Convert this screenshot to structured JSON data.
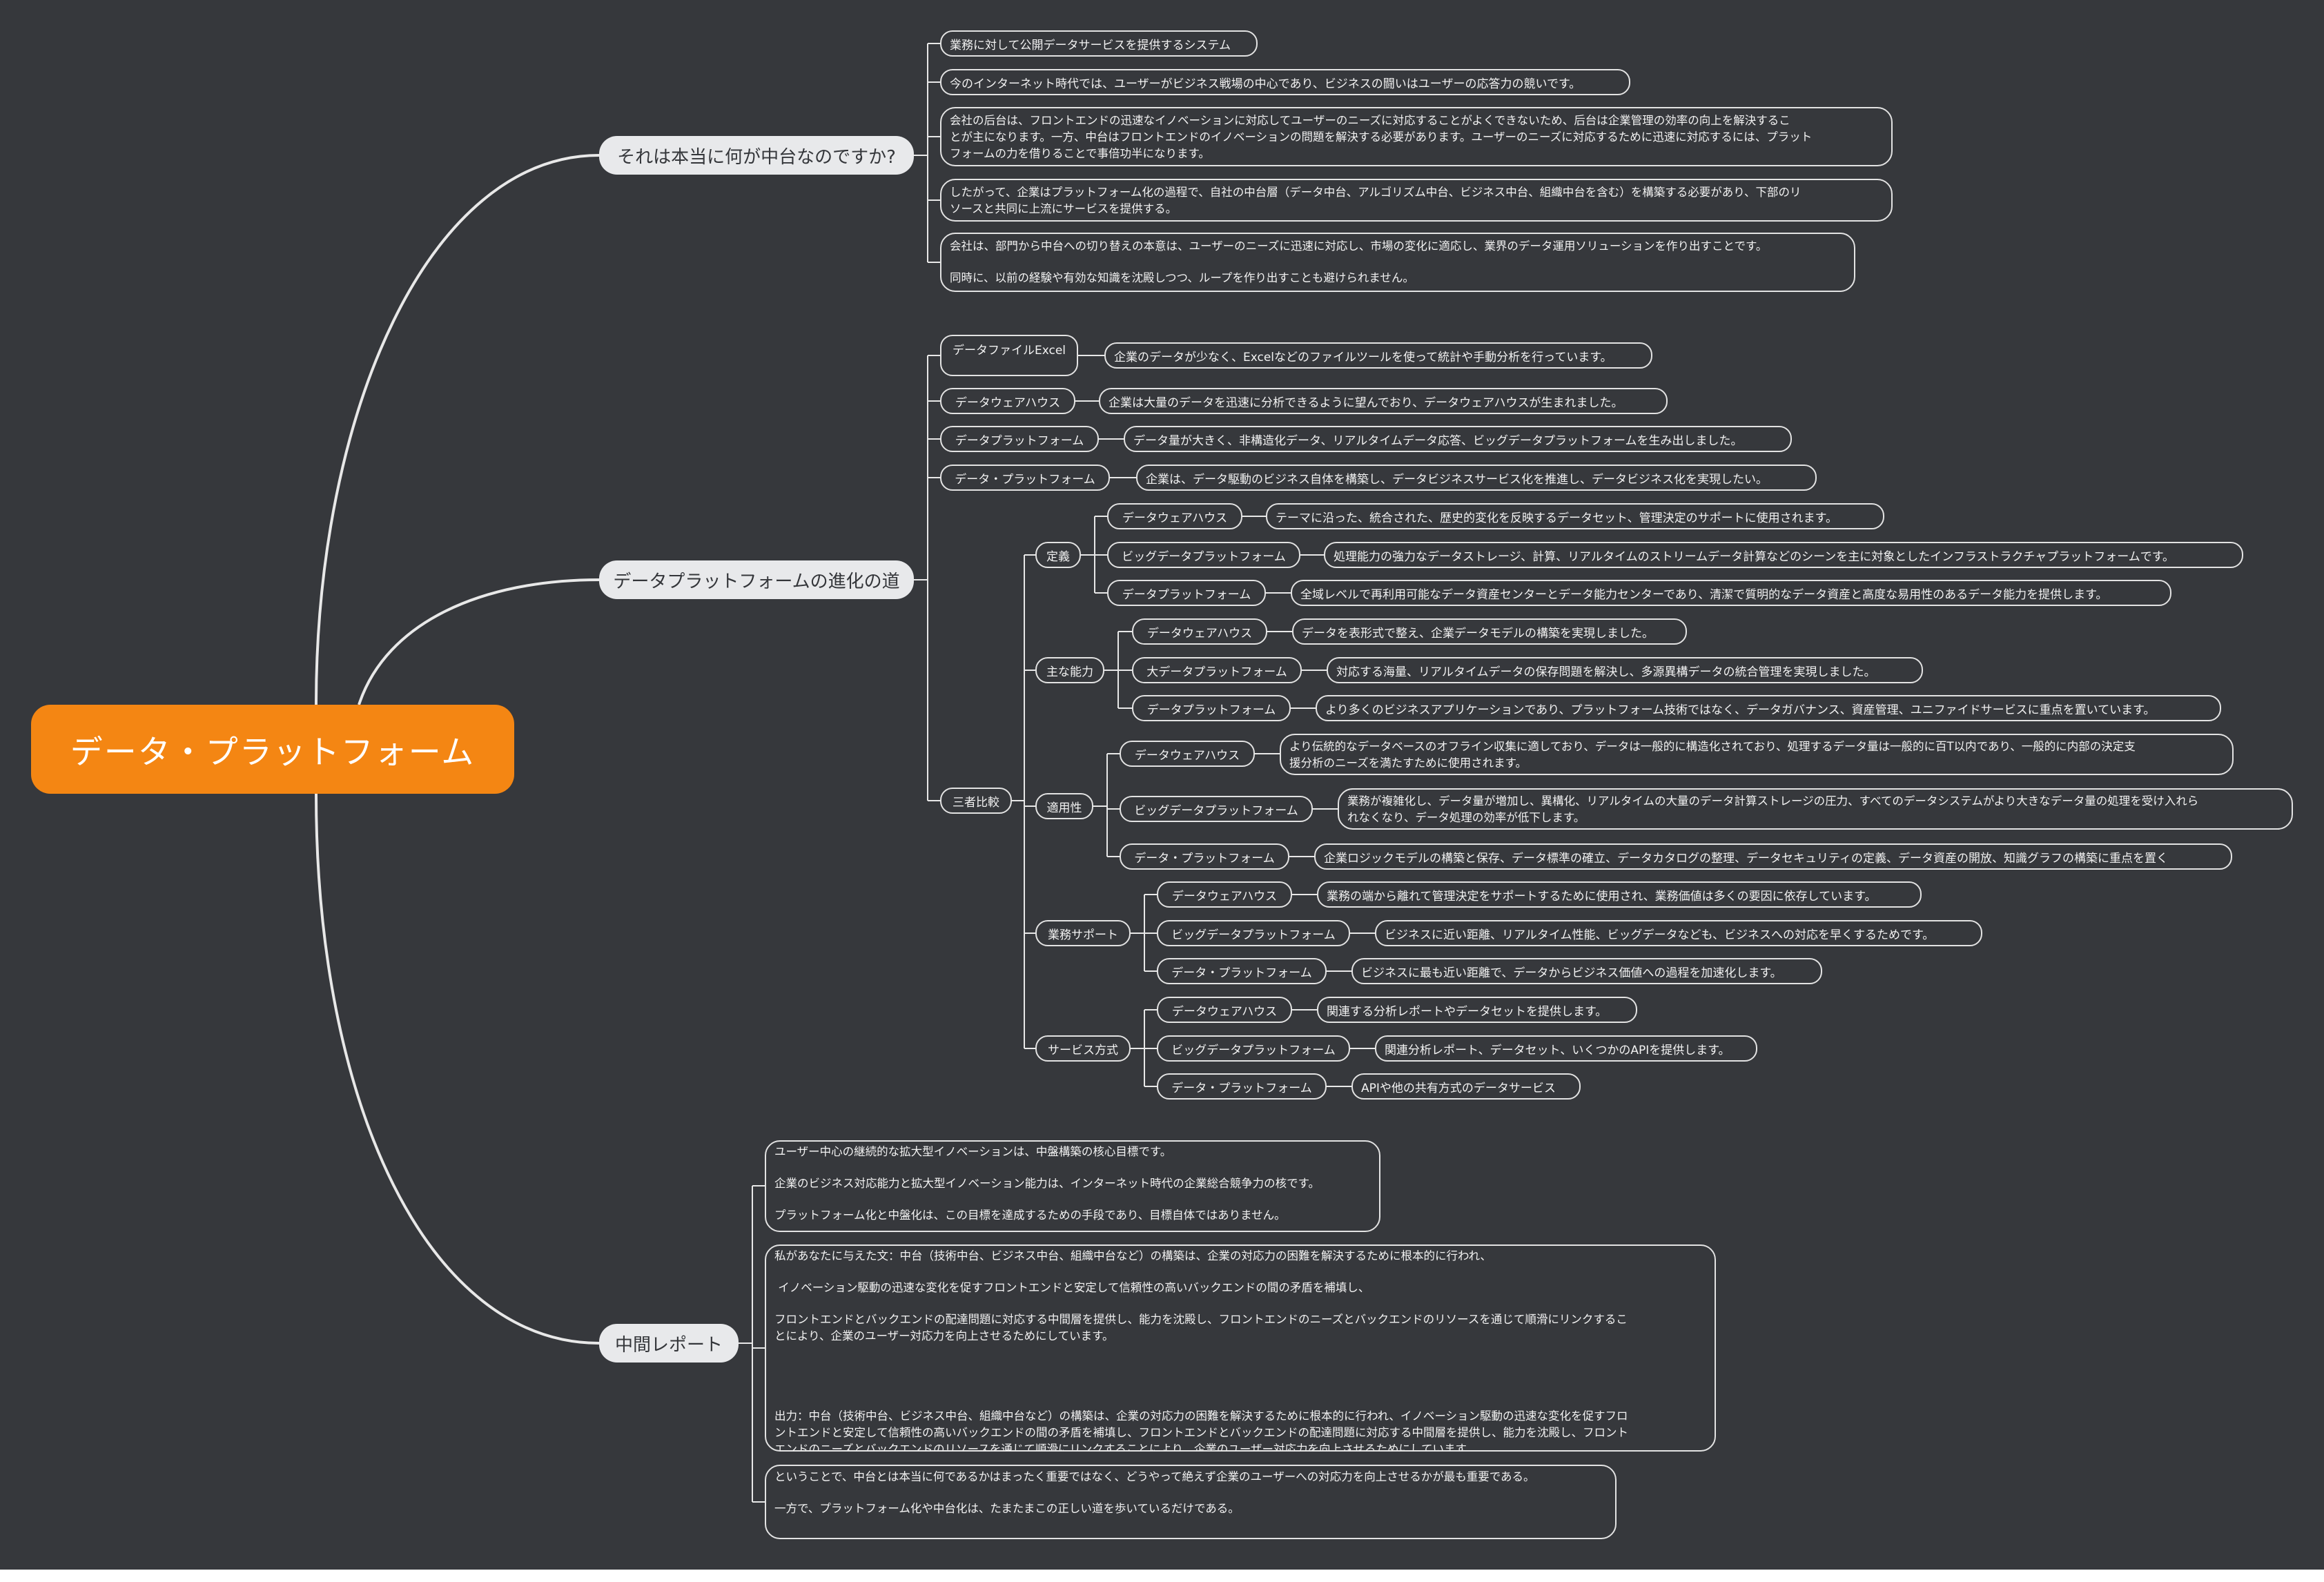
{
  "central": "データ・プラットフォーム",
  "branches": {
    "b1": {
      "title": "それは本当に何が中台なのですか?",
      "items": [
        "業務に対して公開データサービスを提供するシステム",
        "今のインターネット時代では、ユーザーがビジネス戦場の中心であり、ビジネスの闘いはユーザーの応答力の競いです。",
        [
          "会社の后台は、フロントエンドの迅速なイノベーションに対応してユーザーのニーズに対応することがよくできないため、后台は企業管理の効率の向上を解決するこ",
          "とが主になります。一方、中台はフロントエンドのイノベーションの問題を解決する必要があります。ユーザーのニーズに対応するために迅速に対応するには、プラット",
          "フォームの力を借りることで事倍功半になります。"
        ],
        [
          "したがって、企業はプラットフォーム化の過程で、自社の中台層（データ中台、アルゴリズム中台、ビジネス中台、組織中台を含む）を構築する必要があり、下部のリ",
          "ソースと共同に上流にサービスを提供する。"
        ],
        [
          "会社は、部門から中台への切り替えの本意は、ユーザーのニーズに迅速に対応し、市場の変化に適応し、業界のデータ運用ソリューションを作り出すことです。",
          "同時に、以前の経験や有効な知識を沈殿しつつ、ループを作り出すことも避けられません。"
        ]
      ]
    },
    "b2": {
      "title": "データプラットフォームの進化の道",
      "stages": [
        {
          "name": "データファイルExcel",
          "desc": "企業のデータが少なく、Excelなどのファイルツールを使って統計や手動分析を行っています。"
        },
        {
          "name": "データウェアハウス",
          "desc": "企業は大量のデータを迅速に分析できるように望んでおり、データウェアハウスが生まれました。"
        },
        {
          "name": "データプラットフォーム",
          "desc": "データ量が大きく、非構造化データ、リアルタイムデータ応答、ビッグデータプラットフォームを生み出しました。"
        },
        {
          "name": "データ・プラットフォーム",
          "desc": "企業は、データ駆動のビジネス自体を構築し、データビジネスサービス化を推進し、データビジネス化を実現したい。"
        }
      ],
      "comparison": {
        "title": "三者比較",
        "groups": [
          {
            "name": "定義",
            "rows": [
              {
                "label": "データウェアハウス",
                "text": "テーマに沿った、統合された、歴史的変化を反映するデータセット、管理決定のサポートに使用されます。"
              },
              {
                "label": "ビッグデータプラットフォーム",
                "text": "処理能力の強力なデータストレージ、計算、リアルタイムのストリームデータ計算などのシーンを主に対象としたインフラストラクチャプラットフォームです。"
              },
              {
                "label": "データプラットフォーム",
                "text": "全域レベルで再利用可能なデータ資産センターとデータ能力センターであり、清潔で質明的なデータ資産と高度な易用性のあるデータ能力を提供します。"
              }
            ]
          },
          {
            "name": "主な能力",
            "rows": [
              {
                "label": "データウェアハウス",
                "text": "データを表形式で整え、企業データモデルの構築を実現しました。"
              },
              {
                "label": "大データプラットフォーム",
                "text": "対応する海量、リアルタイムデータの保存問題を解決し、多源異構データの統合管理を実現しました。"
              },
              {
                "label": "データプラットフォーム",
                "text": "より多くのビジネスアプリケーションであり、プラットフォーム技術ではなく、データガバナンス、資産管理、ユニファイドサービスに重点を置いています。"
              }
            ]
          },
          {
            "name": "適用性",
            "rows": [
              {
                "label": "データウェアハウス",
                "text": [
                  "より伝統的なデータベースのオフライン収集に適しており、データは一般的に構造化されており、処理するデータ量は一般的に百T以内であり、一般的に内部の決定支",
                  "援分析のニーズを満たすために使用されます。"
                ]
              },
              {
                "label": "ビッグデータプラットフォーム",
                "text": [
                  "業務が複雑化し、データ量が増加し、異構化、リアルタイムの大量のデータ計算ストレージの圧力、すべてのデータシステムがより大きなデータ量の処理を受け入れら",
                  "れなくなり、データ処理の効率が低下します。"
                ]
              },
              {
                "label": "データ・プラットフォーム",
                "text": "企業ロジックモデルの構築と保存、データ標準の確立、データカタログの整理、データセキュリティの定義、データ資産の開放、知識グラフの構築に重点を置く"
              }
            ]
          },
          {
            "name": "業務サポート",
            "rows": [
              {
                "label": "データウェアハウス",
                "text": "業務の端から離れて管理決定をサポートするために使用され、業務価値は多くの要因に依存しています。"
              },
              {
                "label": "ビッグデータプラットフォーム",
                "text": "ビジネスに近い距離、リアルタイム性能、ビッグデータなども、ビジネスへの対応を早くするためです。"
              },
              {
                "label": "データ・プラットフォーム",
                "text": "ビジネスに最も近い距離で、データからビジネス価値への過程を加速化します。"
              }
            ]
          },
          {
            "name": "サービス方式",
            "rows": [
              {
                "label": "データウェアハウス",
                "text": "関連する分析レポートやデータセットを提供します。"
              },
              {
                "label": "ビッグデータプラットフォーム",
                "text": "関連分析レポート、データセット、いくつかのAPIを提供します。"
              },
              {
                "label": "データ・プラットフォーム",
                "text": "APIや他の共有方式のデータサービス"
              }
            ]
          }
        ]
      }
    },
    "b3": {
      "title": "中間レポート",
      "blocks": [
        [
          "ユーザー中心の継続的な拡大型イノベーションは、中盤構築の核心目標です。",
          "",
          "企業のビジネス対応能力と拡大型イノベーション能力は、インターネット時代の企業総合競争力の核です。",
          "",
          "プラットフォーム化と中盤化は、この目標を達成するための手段であり、目標自体ではありません。"
        ],
        [
          "私があなたに与えた文：中台（技術中台、ビジネス中台、組織中台など）の構築は、企業の対応力の困難を解決するために根本的に行われ、",
          "",
          " イノベーション駆動の迅速な変化を促すフロントエンドと安定して信頼性の高いバックエンドの間の矛盾を補填し、",
          "",
          "フロントエンドとバックエンドの配達問題に対応する中間層を提供し、能力を沈殿し、フロントエンドのニーズとバックエンドのリソースを通じて順滑にリンクするこ",
          "とにより、企業のユーザー対応力を向上させるためにしています。",
          "",
          "",
          "",
          "出力：中台（技術中台、ビジネス中台、組織中台など）の構築は、企業の対応力の困難を解決するために根本的に行われ、イノベーション駆動の迅速な変化を促すフロ",
          "ントエンドと安定して信頼性の高いバックエンドの間の矛盾を補填し、フロントエンドとバックエンドの配達問題に対応する中間層を提供し、能力を沈殿し、フロント",
          "エンドのニーズとバックエンドのリソースを通じて順滑にリンクすることにより、企業のユーザー対応力を向上させるためにしています。"
        ],
        [
          "ということで、中台とは本当に何であるかはまったく重要ではなく、どうやって絶えず企業のユーザーへの対応力を向上させるかが最も重要である。",
          "",
          "一方で、プラットフォーム化や中台化は、たまたまこの正しい道を歩いているだけである。"
        ]
      ]
    }
  }
}
